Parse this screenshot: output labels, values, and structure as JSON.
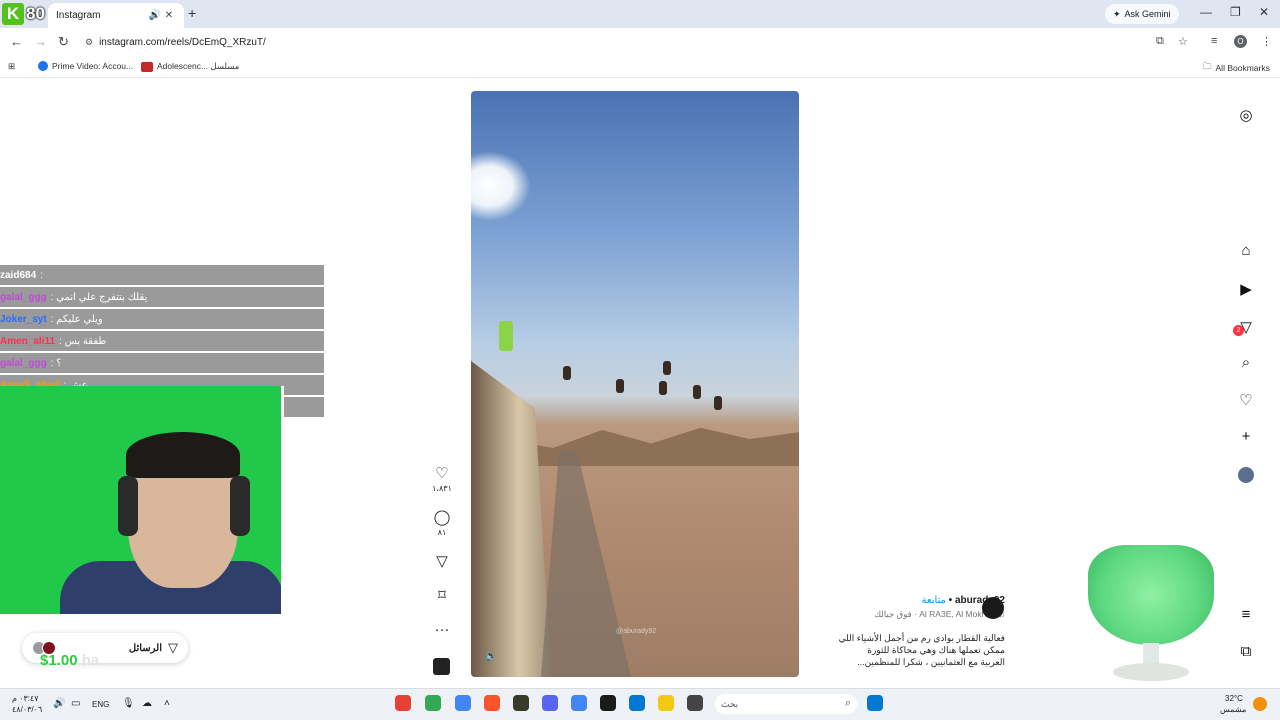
{
  "browser": {
    "tab_title": "Instagram",
    "url": "instagram.com/reels/DcEmQ_XRzuT/",
    "gemini_label": "Ask Gemini",
    "profile_initial": "O",
    "bookmarks": [
      "Prime Video: Accou...",
      "Adolescenc... مسلسل"
    ],
    "all_bookmarks": "All Bookmarks",
    "stream_logo_number": "80"
  },
  "reel": {
    "watermark": "@aburady92",
    "likes": "١،٨٣١",
    "comments": "٨١",
    "username": "aburady92",
    "follow": "متابعة",
    "audio": "Al RA3E, Al Mokhtar · فوق جبالك",
    "caption_lines": [
      "فعالية القطار بوادي رم من أجمل الأشياء اللي",
      "ممكن تعملها هناك وهي محاكاة للثورة",
      "العربية مع العثمانيين ، شكرا للمنظمين..."
    ]
  },
  "sidebar": {
    "messages_badge": "2"
  },
  "stream": {
    "chat": [
      {
        "user": "zaid684",
        "text": ":",
        "color": "#ffffff"
      },
      {
        "user": "galal_ggg",
        "text": ": يقلك بتتفرج علي انمي",
        "color": "#c04bd8"
      },
      {
        "user": "Joker_syt",
        "text": ": ويلي عليكم",
        "color": "#2a6bff"
      },
      {
        "user": "Amen_ali11",
        "text": ": طفقة بس",
        "color": "#ff2d55"
      },
      {
        "user": "galal_ggg",
        "text": ": ؟",
        "color": "#c04bd8"
      },
      {
        "user": "Amadi_abed",
        "text": ": عش",
        "color": "#ff9800"
      },
      {
        "user": "",
        "text": "",
        "color": "#ffffff"
      }
    ],
    "messages_label": "الرسائل",
    "messages_badge": "2",
    "donation": "$1.00",
    "donation_suffix": "ha"
  },
  "taskbar": {
    "time": "٠٣:٤٧ م",
    "date": "٤٨/٠٣/٠٦",
    "lang": "ENG",
    "search_placeholder": "بحث",
    "temperature": "32°C",
    "weather": "مشمس"
  }
}
